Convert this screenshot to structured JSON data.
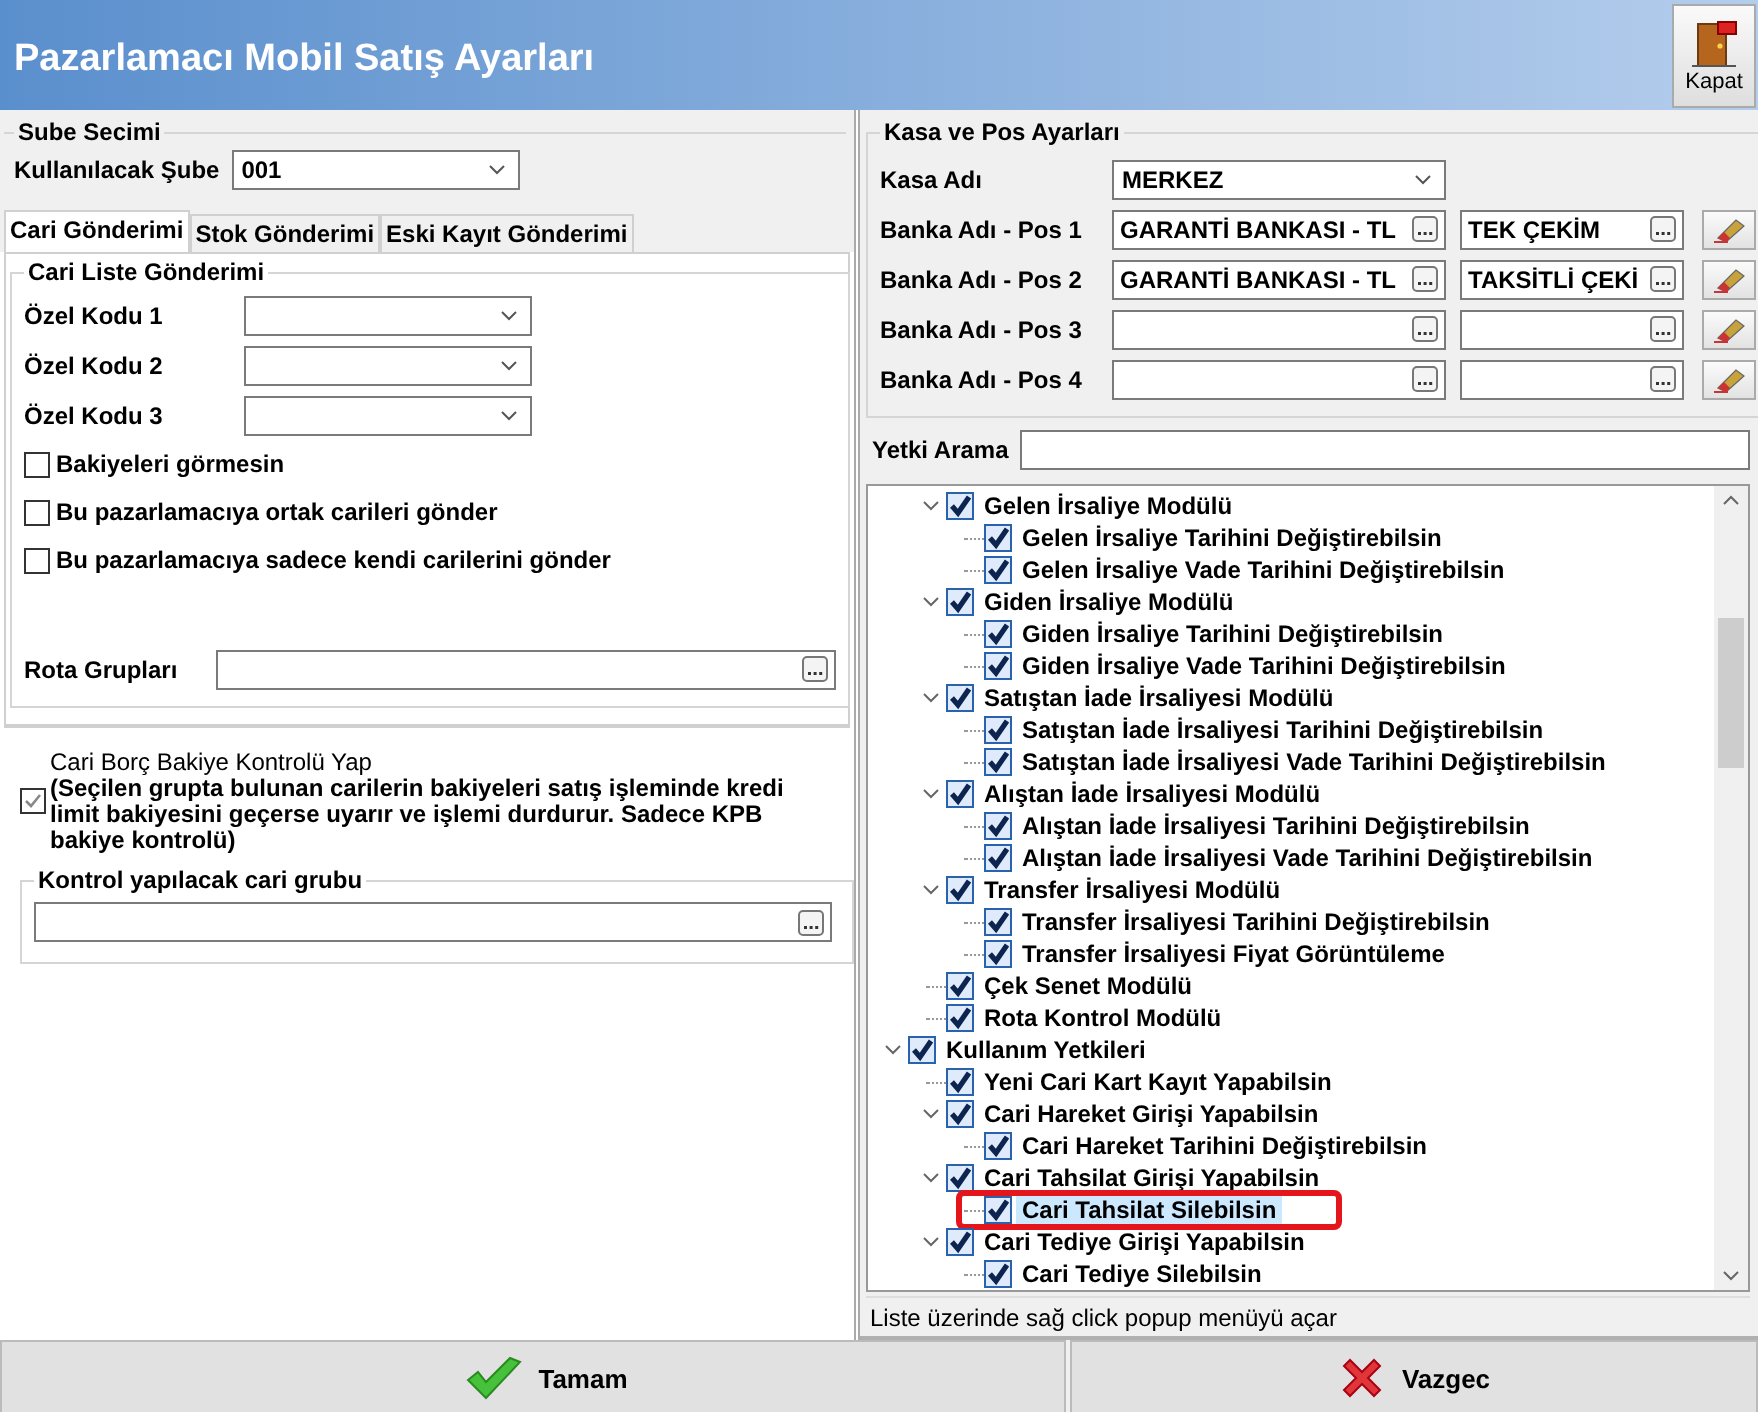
{
  "window": {
    "title": "Pazarlamacı Mobil Satış Ayarları",
    "close_button": "Kapat"
  },
  "branch": {
    "legend": "Sube Secimi",
    "label": "Kullanılacak Şube",
    "value": "001"
  },
  "tabs": [
    {
      "label": "Cari Gönderimi",
      "selected": true
    },
    {
      "label": "Stok Gönderimi",
      "selected": false
    },
    {
      "label": "Eski Kayıt Gönderimi",
      "selected": false
    }
  ],
  "cari_list": {
    "legend": "Cari Liste Gönderimi",
    "special_codes": [
      {
        "label": "Özel Kodu 1"
      },
      {
        "label": "Özel Kodu 2"
      },
      {
        "label": "Özel Kodu 3"
      }
    ],
    "options": [
      {
        "label": "Bakiyeleri görmesin",
        "checked": false
      },
      {
        "label": "Bu pazarlamacıya ortak carileri gönder",
        "checked": false
      },
      {
        "label": "Bu pazarlamacıya sadece kendi carilerini gönder",
        "checked": false
      }
    ],
    "route_label": "Rota Grupları"
  },
  "balance_check": {
    "title": "Cari Borç Bakiye Kontrolü Yap",
    "description": "(Seçilen grupta bulunan carilerin bakiyeleri satış işleminde kredi limit bakiyesini geçerse uyarır ve işlemi durdurur. Sadece KPB bakiye kontrolü)",
    "checked": true
  },
  "control_group": {
    "legend": "Kontrol yapılacak cari grubu"
  },
  "cash_pos": {
    "legend": "Kasa ve Pos Ayarları",
    "cash_label": "Kasa Adı",
    "cash_value": "MERKEZ",
    "pos_rows": [
      {
        "label": "Banka Adı - Pos 1",
        "bank": "GARANTİ BANKASI - TL",
        "plan": "TEK ÇEKİM"
      },
      {
        "label": "Banka Adı - Pos 2",
        "bank": "GARANTİ BANKASI - TL",
        "plan": "TAKSİTLİ ÇEKİ"
      },
      {
        "label": "Banka Adı - Pos 3"
      },
      {
        "label": "Banka Adı - Pos 4"
      }
    ]
  },
  "search": {
    "label": "Yetki Arama"
  },
  "tree": {
    "selection_outline": true,
    "items": [
      {
        "children": [
          {
            "label": "Gelen İrsaliye Modülü",
            "checked": true,
            "expanded": true,
            "selected": false,
            "children": [
              {
                "label": "Gelen İrsaliye Tarihini Değiştirebilsin",
                "checked": true,
                "selected": false
              },
              {
                "label": "Gelen İrsaliye Vade Tarihini Değiştirebilsin",
                "checked": true,
                "selected": false
              }
            ]
          },
          {
            "label": "Giden İrsaliye Modülü",
            "checked": true,
            "expanded": true,
            "selected": false,
            "children": [
              {
                "label": "Giden İrsaliye Tarihini Değiştirebilsin",
                "checked": true,
                "selected": false
              },
              {
                "label": "Giden İrsaliye Vade Tarihini Değiştirebilsin",
                "checked": true,
                "selected": false
              }
            ]
          },
          {
            "label": "Satıştan İade İrsaliyesi Modülü",
            "checked": true,
            "expanded": true,
            "selected": false,
            "children": [
              {
                "label": "Satıştan İade İrsaliyesi Tarihini Değiştirebilsin",
                "checked": true,
                "selected": false
              },
              {
                "label": "Satıştan İade İrsaliyesi Vade Tarihini Değiştirebilsin",
                "checked": true,
                "selected": false
              }
            ]
          },
          {
            "label": "Alıştan İade İrsaliyesi Modülü",
            "checked": true,
            "expanded": true,
            "selected": false,
            "children": [
              {
                "label": "Alıştan İade İrsaliyesi Tarihini Değiştirebilsin",
                "checked": true,
                "selected": false
              },
              {
                "label": "Alıştan İade İrsaliyesi Vade Tarihini Değiştirebilsin",
                "checked": true,
                "selected": false
              }
            ]
          },
          {
            "label": "Transfer İrsaliyesi Modülü",
            "checked": true,
            "expanded": true,
            "selected": false,
            "children": [
              {
                "label": "Transfer İrsaliyesi Tarihini Değiştirebilsin",
                "checked": true,
                "selected": false
              },
              {
                "label": "Transfer İrsaliyesi Fiyat Görüntüleme",
                "checked": true,
                "selected": false
              }
            ]
          },
          {
            "label": "Çek Senet Modülü",
            "checked": true,
            "selected": false
          },
          {
            "label": "Rota Kontrol Modülü",
            "checked": true,
            "selected": false
          }
        ]
      },
      {
        "label": "Kullanım Yetkileri",
        "checked": true,
        "expanded": true,
        "selected": false,
        "children": [
          {
            "label": "Yeni Cari Kart Kayıt Yapabilsin",
            "checked": true,
            "selected": false
          },
          {
            "label": "Cari Hareket Girişi Yapabilsin",
            "checked": true,
            "expanded": true,
            "selected": false,
            "children": [
              {
                "label": "Cari Hareket Tarihini Değiştirebilsin",
                "checked": true,
                "selected": false
              }
            ]
          },
          {
            "label": "Cari Tahsilat Girişi Yapabilsin",
            "checked": true,
            "expanded": true,
            "selected": false,
            "children": [
              {
                "label": "Cari Tahsilat Silebilsin",
                "checked": true,
                "selected": true
              }
            ]
          },
          {
            "label": "Cari Tediye Girişi Yapabilsin",
            "checked": true,
            "expanded": true,
            "selected": false,
            "children": [
              {
                "label": "Cari Tediye Silebilsin",
                "checked": true,
                "selected": false
              }
            ]
          }
        ]
      }
    ]
  },
  "status_bar": "Liste üzerinde sağ click popup menüyü açar",
  "buttons": [
    {
      "kind": "ok",
      "label": "Tamam"
    },
    {
      "kind": "cancel",
      "label": "Vazgec"
    }
  ]
}
